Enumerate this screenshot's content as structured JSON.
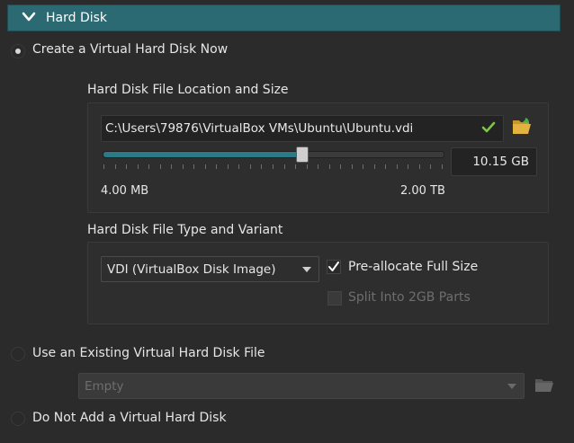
{
  "section": {
    "title": "Hard Disk",
    "expanded": true
  },
  "options": {
    "create_now": {
      "label": "Create a Virtual Hard Disk Now",
      "selected": true
    },
    "use_existing": {
      "label": "Use an Existing Virtual Hard Disk File",
      "selected": false
    },
    "do_not_add": {
      "label": "Do Not Add a Virtual Hard Disk",
      "selected": false
    }
  },
  "location": {
    "group_label": "Hard Disk File Location and Size",
    "path": "C:\\Users\\79876\\VirtualBox VMs\\Ubuntu\\Ubuntu.vdi",
    "size_value": "10.15 GB",
    "min_label": "4.00 MB",
    "max_label": "2.00 TB",
    "slider_fraction": 0.585
  },
  "type_variant": {
    "group_label": "Hard Disk File Type and Variant",
    "type_selected": "VDI (VirtualBox Disk Image)",
    "preallocate": {
      "label": "Pre-allocate Full Size",
      "checked": true
    },
    "split": {
      "label": "Split Into 2GB Parts",
      "checked": false,
      "enabled": false
    }
  },
  "existing": {
    "selected": "Empty",
    "enabled": false
  },
  "colors": {
    "accent": "#2b6a72",
    "slider_fill": "#2b7b86",
    "ok_check": "#7ec34a",
    "folder": "#e3b341"
  },
  "icons": [
    "chevron-down-icon",
    "checkmark-icon",
    "folder-open-icon",
    "folder-icon",
    "dropdown-arrow-icon"
  ]
}
